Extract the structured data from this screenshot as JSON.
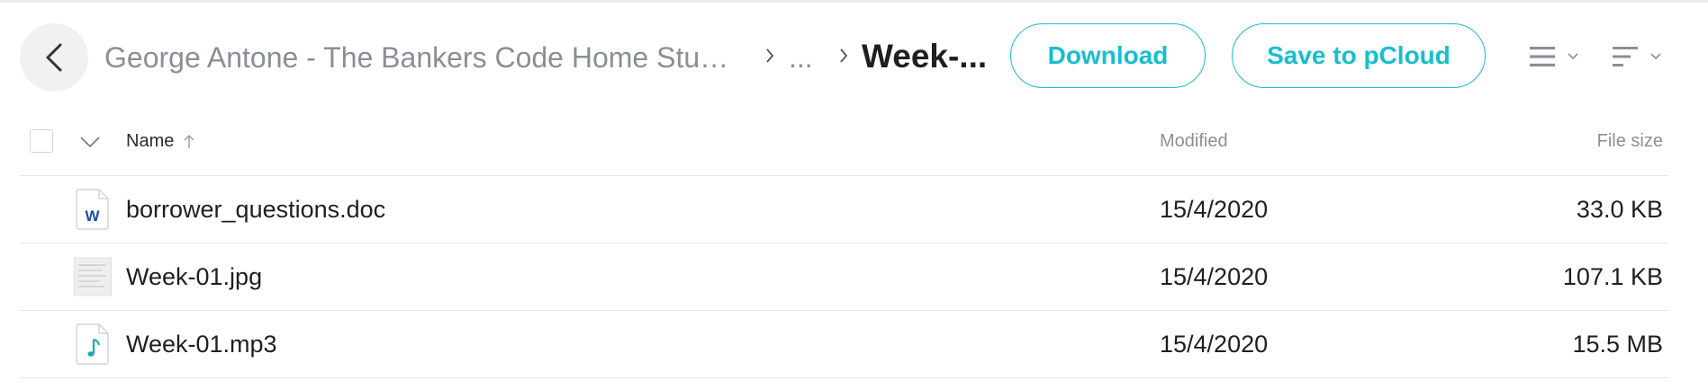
{
  "breadcrumb": {
    "root": "George Antone - The Bankers Code Home Stu…",
    "ellipsis": "...",
    "current": "Week-..."
  },
  "actions": {
    "download_label": "Download",
    "save_label": "Save to pCloud"
  },
  "table": {
    "headers": {
      "name": "Name",
      "modified": "Modified",
      "size": "File size"
    },
    "rows": [
      {
        "name": "borrower_questions.doc",
        "modified": "15/4/2020",
        "size": "33.0 KB",
        "type": "word-doc-icon",
        "icon_letter": "W"
      },
      {
        "name": "Week-01.jpg",
        "modified": "15/4/2020",
        "size": "107.1 KB",
        "type": "image-thumbnail"
      },
      {
        "name": "Week-01.mp3",
        "modified": "15/4/2020",
        "size": "15.5 MB",
        "type": "audio-file-icon"
      }
    ]
  },
  "colors": {
    "accent": "#17bed0",
    "muted_text": "#8a8f96",
    "word_blue": "#1e4aa8"
  },
  "icons": [
    "back-arrow-icon",
    "chevron-right-icon",
    "list-view-icon",
    "sort-icon",
    "chevron-down-icon",
    "sort-up-arrow-icon"
  ]
}
